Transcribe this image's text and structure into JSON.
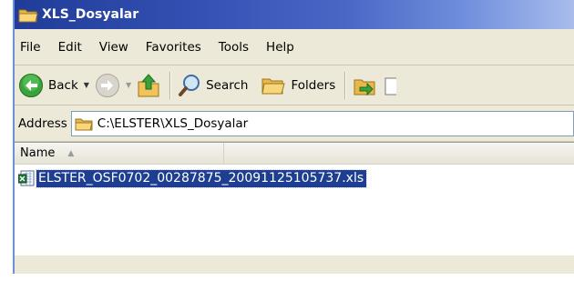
{
  "window": {
    "title": "XLS_Dosyalar"
  },
  "menu": [
    "File",
    "Edit",
    "View",
    "Favorites",
    "Tools",
    "Help"
  ],
  "toolbar": {
    "back_label": "Back",
    "search_label": "Search",
    "folders_label": "Folders"
  },
  "address": {
    "label": "Address",
    "value": "C:\\ELSTER\\XLS_Dosyalar"
  },
  "list": {
    "columns": [
      "Name"
    ],
    "files": [
      {
        "name": "ELSTER_OSF0702_00287875_20091125105737.xls",
        "selected": true
      }
    ]
  },
  "icons": {
    "title": "folder-icon",
    "back": "back-arrow-icon",
    "forward": "forward-arrow-icon",
    "up": "up-folder-icon",
    "search": "search-icon",
    "folders": "folders-icon",
    "move": "move-to-icon",
    "file": "excel-file-icon"
  },
  "colors": {
    "title_bar": "#2a4aa8",
    "selection": "#1e3f91",
    "chrome": "#ece9d8"
  }
}
